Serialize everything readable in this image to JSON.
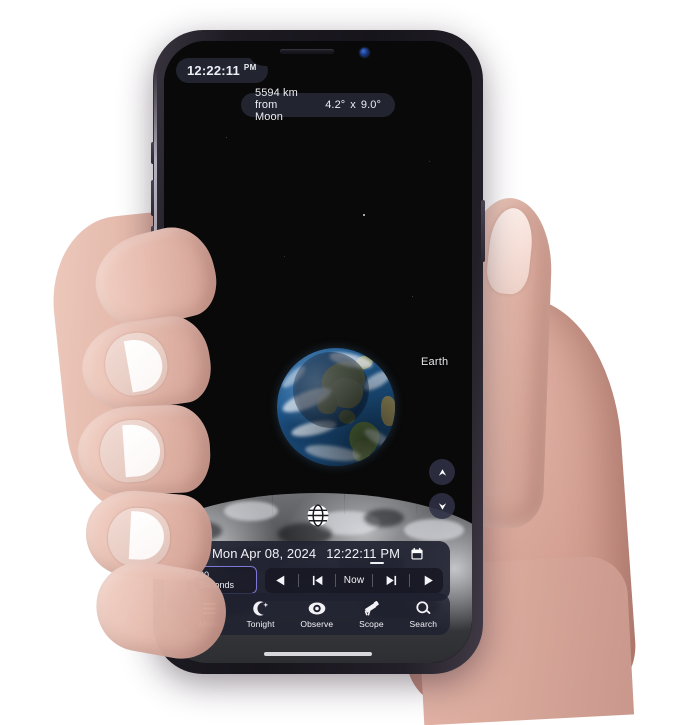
{
  "status": {
    "clock_time": "12:22:11",
    "clock_ampm": "PM"
  },
  "hud": {
    "distance_label": "5594 km from Moon",
    "fov_x": "4.2°",
    "fov_sep": "x",
    "fov_y": "9.0°"
  },
  "sky": {
    "earth_label": "Earth"
  },
  "controls": {
    "zoom_in_icon": "chevron-up-icon",
    "zoom_out_icon": "chevron-down-icon",
    "globe_icon": "globe-icon"
  },
  "timebar": {
    "date": "Mon Apr 08, 2024",
    "time": "12:22:11 PM",
    "calendar_icon": "calendar-icon",
    "rate_value": "30",
    "rate_unit": "Seconds",
    "transport": {
      "reverse_label": "reverse-play",
      "step_back_label": "step-backward",
      "now_label": "Now",
      "step_forward_label": "step-forward",
      "play_label": "play"
    }
  },
  "navbar": {
    "items": [
      {
        "label": "Menu",
        "icon": "hamburger-menu-icon"
      },
      {
        "label": "Tonight",
        "icon": "crescent-moon-star-icon"
      },
      {
        "label": "Observe",
        "icon": "eye-icon"
      },
      {
        "label": "Scope",
        "icon": "telescope-icon"
      },
      {
        "label": "Search",
        "icon": "magnifier-icon"
      }
    ]
  },
  "colors": {
    "accent_purple": "#7d78d8",
    "hud_panel": "#222332",
    "text_primary": "#f0f1f6",
    "screen_bg": "#090909"
  }
}
